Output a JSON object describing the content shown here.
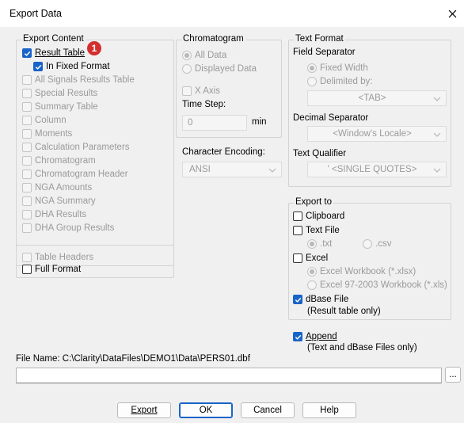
{
  "window": {
    "title": "Export Data"
  },
  "export_content": {
    "legend": "Export Content",
    "items": [
      {
        "label": "Result Table",
        "checked": true,
        "enabled": true
      },
      {
        "label": "In Fixed Format",
        "checked": true,
        "enabled": true
      },
      {
        "label": "All Signals Results Table",
        "checked": false,
        "enabled": false
      },
      {
        "label": "Special Results",
        "checked": false,
        "enabled": false
      },
      {
        "label": "Summary Table",
        "checked": false,
        "enabled": false
      },
      {
        "label": "Column",
        "checked": false,
        "enabled": false
      },
      {
        "label": "Moments",
        "checked": false,
        "enabled": false
      },
      {
        "label": "Calculation Parameters",
        "checked": false,
        "enabled": false
      },
      {
        "label": "Chromatogram",
        "checked": false,
        "enabled": false
      },
      {
        "label": "Chromatogram Header",
        "checked": false,
        "enabled": false
      },
      {
        "label": "NGA Amounts",
        "checked": false,
        "enabled": false
      },
      {
        "label": "NGA Summary",
        "checked": false,
        "enabled": false
      },
      {
        "label": "DHA Results",
        "checked": false,
        "enabled": false
      },
      {
        "label": "DHA Group Results",
        "checked": false,
        "enabled": false
      }
    ],
    "callout": "1"
  },
  "table_options": {
    "table_headers": "Table Headers",
    "full_format": "Full Format"
  },
  "chromatogram": {
    "legend": "Chromatogram",
    "all_data": "All Data",
    "displayed_data": "Displayed Data",
    "x_axis": "X Axis",
    "time_step_label": "Time Step:",
    "time_step_value": "0",
    "time_step_unit": "min"
  },
  "encoding": {
    "label": "Character Encoding:",
    "value": "ANSI"
  },
  "text_format": {
    "legend": "Text Format",
    "field_separator": "Field Separator",
    "fixed_width": "Fixed Width",
    "delimited_by": "Delimited by:",
    "delimiter_value": "<TAB>",
    "decimal_separator": "Decimal Separator",
    "decimal_value": "<Window's Locale>",
    "text_qualifier": "Text Qualifier",
    "qualifier_value": "'  <SINGLE QUOTES>"
  },
  "export_to": {
    "legend": "Export to",
    "clipboard": "Clipboard",
    "text_file": "Text File",
    "txt": ".txt",
    "csv": ".csv",
    "excel": "Excel",
    "excel_xlsx": "Excel Workbook (*.xlsx)",
    "excel_xls": "Excel 97-2003 Workbook (*.xls)",
    "dbase": "dBase File",
    "dbase_note": "(Result table only)"
  },
  "append": {
    "label": "Append",
    "note": "(Text and dBase Files only)"
  },
  "file_name": {
    "label": "File Name: C:\\Clarity\\DataFiles\\DEMO1\\Data\\PERS01.dbf",
    "value": "",
    "browse": "..."
  },
  "buttons": {
    "export": "Export",
    "ok": "OK",
    "cancel": "Cancel",
    "help": "Help"
  },
  "colors": {
    "accent": "#1964c8",
    "callout": "#d32f2f"
  }
}
